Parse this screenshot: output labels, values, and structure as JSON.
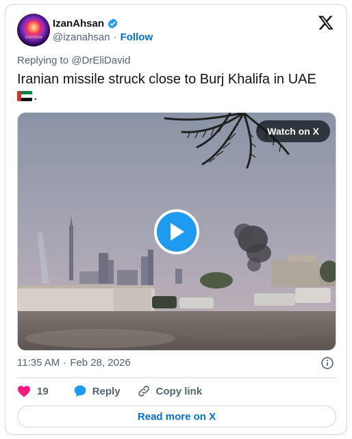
{
  "author": {
    "display_name": "IzanAhsan",
    "handle": "@izanahsan",
    "separator": "·",
    "follow_label": "Follow",
    "verified": true,
    "avatar_text": "IZAN AHSAN"
  },
  "tweet": {
    "replying_to": "Replying to @DrEliDavid",
    "text": "Iranian missile struck close to Burj Khalifa in UAE",
    "trailing_text": ".",
    "flag_emoji": "UAE flag"
  },
  "media": {
    "watch_label": "Watch on X",
    "play_icon": "play-icon"
  },
  "meta": {
    "time": "11:35 AM",
    "separator": "·",
    "date": "Feb 28, 2026"
  },
  "actions": {
    "like_count": "19",
    "reply_label": "Reply",
    "copy_label": "Copy link"
  },
  "footer": {
    "read_more_label": "Read more on X"
  },
  "colors": {
    "accent": "#1d9bf0",
    "link": "#006fd6",
    "like": "#f91880",
    "muted": "#536471",
    "border": "#cfd9de"
  }
}
